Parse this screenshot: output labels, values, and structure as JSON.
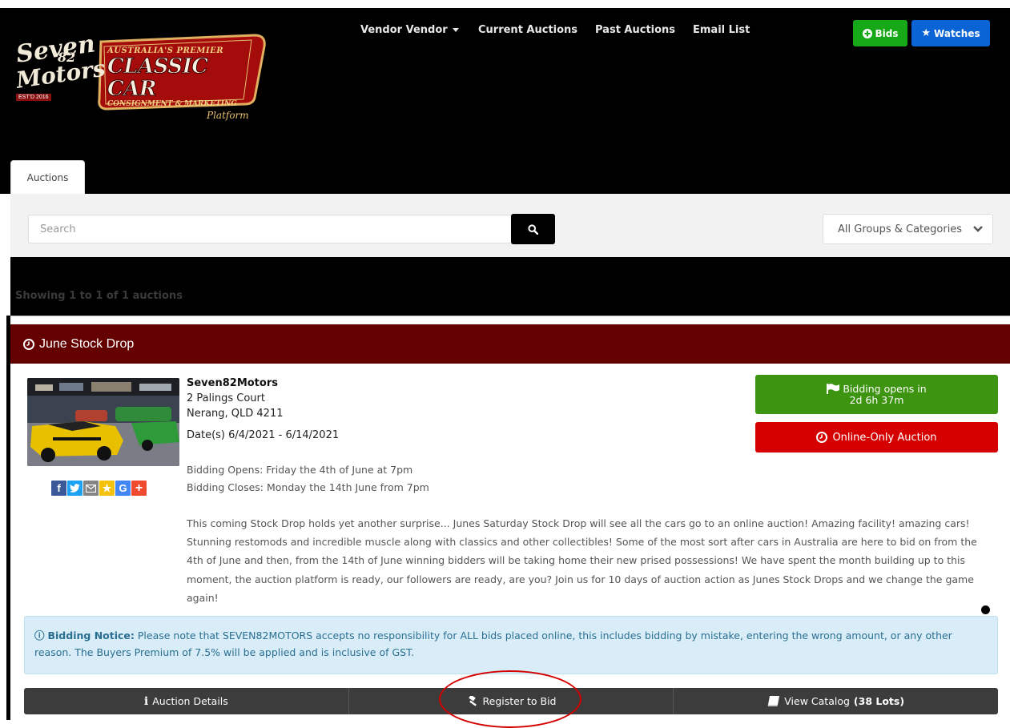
{
  "logo": {
    "line1": "Seven",
    "line2": "82",
    "line3": "Motors",
    "tag": "AUSTRALIA'S PREMIER",
    "main": "CLASSIC CAR",
    "sub": "CONSIGNMENT & MARKETING",
    "platform": "Platform",
    "est": "EST'D 2016"
  },
  "nav": {
    "vendor": "Vendor Vendor",
    "current": "Current Auctions",
    "past": "Past Auctions",
    "email": "Email List"
  },
  "top_buttons": {
    "bids": "Bids",
    "watches": "Watches",
    "bids_color": "#16a816",
    "watches_color": "#0a64d6"
  },
  "tab": {
    "label": "Auctions"
  },
  "search": {
    "placeholder": "Search",
    "category": "All Groups & Categories"
  },
  "results": {
    "showing": "Showing 1 to 1 of 1 auctions"
  },
  "auction": {
    "title": "June Stock Drop",
    "vendor": "Seven82Motors",
    "address1": "2 Palings Court",
    "address2": "Nerang, QLD 4211",
    "dates": "Date(s) 6/4/2021 - 6/14/2021",
    "opens": "Bidding Opens: Friday the 4th of June at 7pm",
    "closes": "Bidding Closes: Monday the 14th June from 7pm",
    "description": "This coming Stock Drop holds yet another surprise... Junes Saturday Stock Drop will see all the cars go to an online auction! Amazing facility! amazing cars! Stunning restomods and incredible muscle along with classics and other collectibles! Some of the most sort after cars in Australia are here to bid on from the 4th of June and then, from the 14th of June winning bidders will be taking home their new prised possessions! We have spent the month building up to this moment, the auction platform is ready, our followers are ready, are you? Join us for 10 days of auction action as Junes Stock Drops and we change the game again!",
    "bidding_opens_label": "Bidding opens in",
    "bidding_opens_time": "2d 6h 37m",
    "type": "Online-Only Auction"
  },
  "notice": {
    "label": "Bidding Notice:",
    "text": "Please note that SEVEN82MOTORS accepts no responsibility for ALL bids placed online, this includes bidding by mistake, entering the wrong amount, or any other reason. The Buyers Premium of 7.5% will be applied and is inclusive of GST."
  },
  "actions": {
    "details": "Auction Details",
    "register": "Register to Bid",
    "catalog": "View Catalog",
    "catalog_count": "(38 Lots)"
  },
  "social": {
    "icons": [
      "facebook-icon",
      "twitter-icon",
      "email-icon",
      "favorite-icon",
      "google-icon",
      "plus-icon"
    ],
    "google_letter": "G",
    "facebook_letter": "f",
    "plus": "+",
    "star": "★"
  }
}
